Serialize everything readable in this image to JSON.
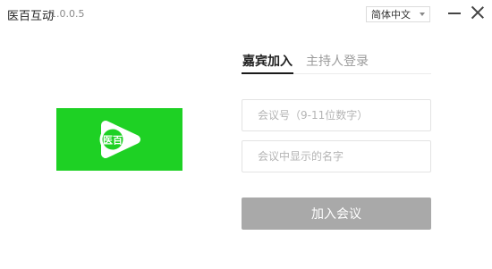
{
  "window": {
    "title": "医百互动",
    "version": "1.0.0.5",
    "language": "简体中文",
    "minimize_icon": "minimize-icon",
    "close_icon": "close-icon"
  },
  "logo": {
    "icon": "play-bubble-logo-icon",
    "text": "医百",
    "background_color": "#1ed124"
  },
  "tabs": [
    {
      "label": "嘉宾加入",
      "active": true
    },
    {
      "label": "主持人登录",
      "active": false
    }
  ],
  "form": {
    "meeting_id_placeholder": "会议号（9-11位数字）",
    "meeting_id_value": "",
    "name_placeholder": "会议中显示的名字",
    "name_value": "",
    "join_label": "加入会议",
    "join_button_color": "#a9a9a9"
  }
}
